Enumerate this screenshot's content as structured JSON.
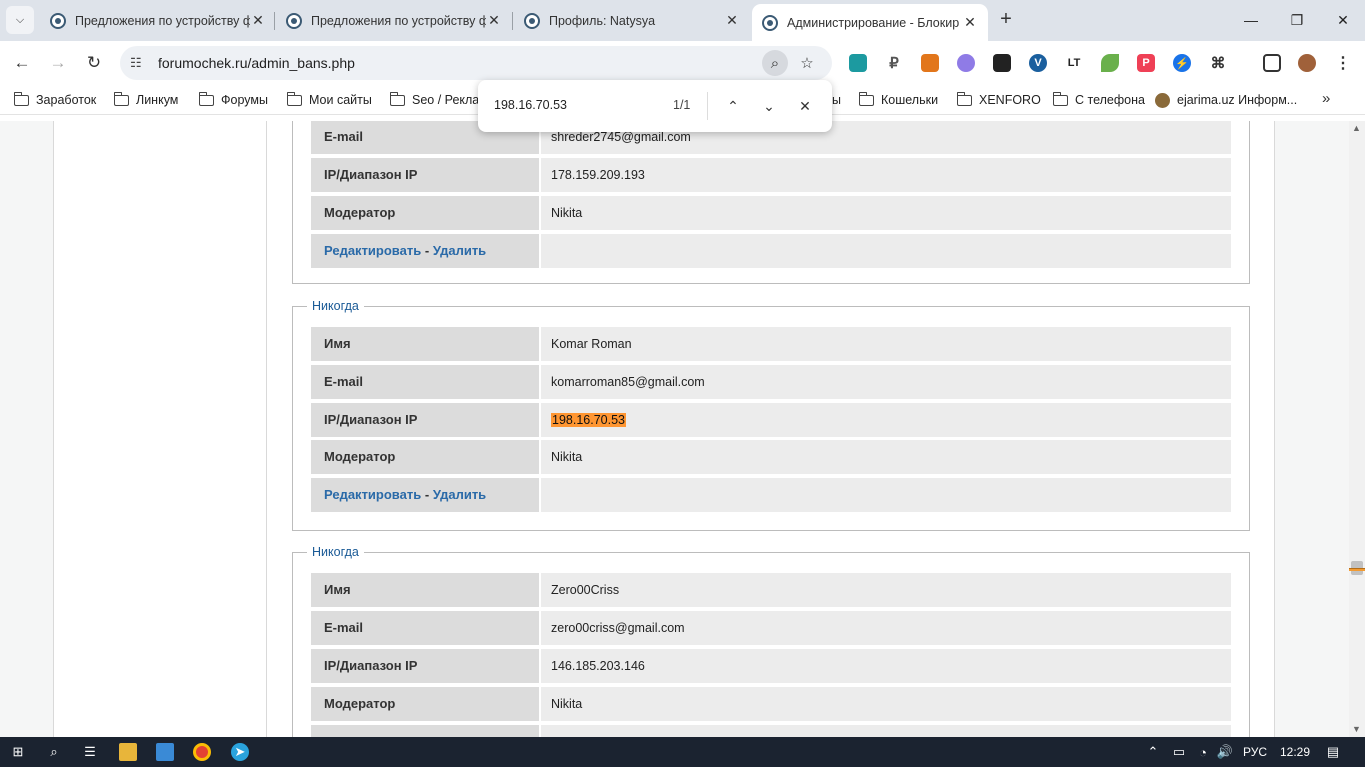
{
  "browser": {
    "tabs": [
      {
        "title": "Предложения по устройству ф",
        "active": false
      },
      {
        "title": "Предложения по устройству ф",
        "active": false
      },
      {
        "title": "Профиль: Natysya",
        "active": false
      },
      {
        "title": "Администрирование - Блокир",
        "active": true
      }
    ],
    "url": "forumochek.ru/admin_bans.php",
    "bookmarks": [
      {
        "label": "Заработок",
        "type": "folder"
      },
      {
        "label": "Линкум",
        "type": "folder"
      },
      {
        "label": "Форумы",
        "type": "folder"
      },
      {
        "label": "Мои сайты",
        "type": "folder"
      },
      {
        "label": "Seo / Реклам",
        "type": "folder"
      },
      {
        "label": "ы",
        "type": "folder"
      },
      {
        "label": "Кошельки",
        "type": "folder"
      },
      {
        "label": "XENFORO",
        "type": "folder"
      },
      {
        "label": "С телефона",
        "type": "folder"
      },
      {
        "label": "ejarima.uz Информ...",
        "type": "site"
      }
    ],
    "extensions": [
      {
        "icon": "ext-teal-icon",
        "color": "#1c9aa0"
      },
      {
        "icon": "ruble-icon",
        "color": "#555555"
      },
      {
        "icon": "metamask-fox-icon",
        "color": "#e2761b"
      },
      {
        "icon": "cloud-icon",
        "color": "#8f7be6"
      },
      {
        "icon": "tiles-icon",
        "color": "#222222"
      },
      {
        "icon": "v-icon",
        "color": "#1a5f9e"
      },
      {
        "icon": "lt-icon",
        "color": "#222222"
      },
      {
        "icon": "leaf-icon",
        "color": "#6ab04c"
      },
      {
        "icon": "pocket-icon",
        "color": "#ef4056"
      },
      {
        "icon": "lightning-icon",
        "color": "#1a73e8"
      },
      {
        "icon": "puzzle-icon",
        "color": "#333333"
      }
    ]
  },
  "find": {
    "query": "198.16.70.53",
    "count": "1/1"
  },
  "bans": [
    {
      "expires": "",
      "rows": [
        {
          "label": "E-mail",
          "value": "shreder2745@gmail.com"
        },
        {
          "label": "IP/Диапазон IP",
          "value": "178.159.209.193"
        },
        {
          "label": "Модератор",
          "value": "Nikita"
        }
      ],
      "actions": {
        "edit": "Редактировать",
        "sep": "-",
        "delete": "Удалить"
      }
    },
    {
      "expires": "Никогда",
      "rows": [
        {
          "label": "Имя",
          "value": "Komar Roman"
        },
        {
          "label": "E-mail",
          "value": "komarroman85@gmail.com"
        },
        {
          "label": "IP/Диапазон IP",
          "value": "198.16.70.53"
        },
        {
          "label": "Модератор",
          "value": "Nikita"
        }
      ],
      "actions": {
        "edit": "Редактировать",
        "sep": "-",
        "delete": "Удалить"
      }
    },
    {
      "expires": "Никогда",
      "rows": [
        {
          "label": "Имя",
          "value": "Zero00Criss"
        },
        {
          "label": "E-mail",
          "value": "zero00criss@gmail.com"
        },
        {
          "label": "IP/Диапазон IP",
          "value": "146.185.203.146"
        },
        {
          "label": "Модератор",
          "value": "Nikita"
        }
      ]
    }
  ],
  "taskbar": {
    "language": "РУС",
    "time": "12:29"
  },
  "colors": {
    "highlight": "#ff9632",
    "link": "#2a6aa8",
    "legend": "#1a5a96"
  }
}
